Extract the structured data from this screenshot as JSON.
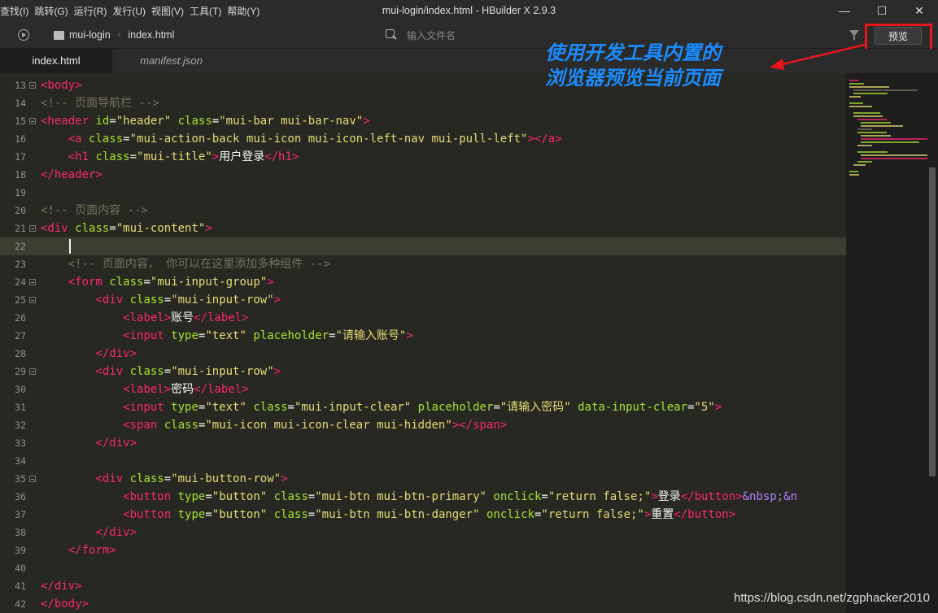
{
  "menu": [
    "查找(I)",
    "跳转(G)",
    "运行(R)",
    "发行(U)",
    "视图(V)",
    "工具(T)",
    "帮助(Y)"
  ],
  "window": {
    "title": "mui-login/index.html - HBuilder X 2.9.3",
    "minimize": "—",
    "maximize": "☐",
    "close": "✕"
  },
  "toolbar": {
    "breadcrumb_project": "mui-login",
    "breadcrumb_file": "index.html",
    "search_placeholder": "输入文件名",
    "preview_label": "预览"
  },
  "tabs": [
    {
      "label": "index.html",
      "active": true
    },
    {
      "label": "manifest.json",
      "active": false
    }
  ],
  "editor": {
    "current_line": 22,
    "lines": [
      {
        "n": "13",
        "fold": true,
        "html": "<span class='t-tag'>&lt;body&gt;</span>"
      },
      {
        "n": "14",
        "fold": false,
        "html": "<span class='t-cmt'>&lt;!-- 页面导航栏 --&gt;</span>"
      },
      {
        "n": "15",
        "fold": true,
        "html": "<span class='t-tag'>&lt;header</span> <span class='t-attr'>id</span>=<span class='t-str'>\"header\"</span> <span class='t-attr'>class</span>=<span class='t-str'>\"mui-bar mui-bar-nav\"</span><span class='t-tag'>&gt;</span>"
      },
      {
        "n": "16",
        "fold": false,
        "html": "    <span class='t-tag'>&lt;a</span> <span class='t-attr'>class</span>=<span class='t-str'>\"mui-action-back mui-icon mui-icon-left-nav mui-pull-left\"</span><span class='t-tag'>&gt;&lt;/a&gt;</span>"
      },
      {
        "n": "17",
        "fold": false,
        "html": "    <span class='t-tag'>&lt;h1</span> <span class='t-attr'>class</span>=<span class='t-str'>\"mui-title\"</span><span class='t-tag'>&gt;</span>用户登录<span class='t-tag'>&lt;/h1&gt;</span>"
      },
      {
        "n": "18",
        "fold": false,
        "html": "<span class='t-tag'>&lt;/header&gt;</span>"
      },
      {
        "n": "19",
        "fold": false,
        "html": ""
      },
      {
        "n": "20",
        "fold": false,
        "html": "<span class='t-cmt'>&lt;!-- 页面内容 --&gt;</span>"
      },
      {
        "n": "21",
        "fold": true,
        "html": "<span class='t-tag'>&lt;div</span> <span class='t-attr'>class</span>=<span class='t-str'>\"mui-content\"</span><span class='t-tag'>&gt;</span>"
      },
      {
        "n": "22",
        "fold": false,
        "html": ""
      },
      {
        "n": "23",
        "fold": false,
        "html": "    <span class='t-cmt'>&lt;!-- 页面内容， 你可以在这里添加多种组件 --&gt;</span>"
      },
      {
        "n": "24",
        "fold": true,
        "html": "    <span class='t-tag'>&lt;form</span> <span class='t-attr'>class</span>=<span class='t-str'>\"mui-input-group\"</span><span class='t-tag'>&gt;</span>"
      },
      {
        "n": "25",
        "fold": true,
        "html": "        <span class='t-tag'>&lt;div</span> <span class='t-attr'>class</span>=<span class='t-str'>\"mui-input-row\"</span><span class='t-tag'>&gt;</span>"
      },
      {
        "n": "26",
        "fold": false,
        "html": "            <span class='t-tag'>&lt;label&gt;</span>账号<span class='t-tag'>&lt;/label&gt;</span>"
      },
      {
        "n": "27",
        "fold": false,
        "html": "            <span class='t-tag'>&lt;input</span> <span class='t-attr'>type</span>=<span class='t-str'>\"text\"</span> <span class='t-attr'>placeholder</span>=<span class='t-str'>\"请输入账号\"</span><span class='t-tag'>&gt;</span>"
      },
      {
        "n": "28",
        "fold": false,
        "html": "        <span class='t-tag'>&lt;/div&gt;</span>"
      },
      {
        "n": "29",
        "fold": true,
        "html": "        <span class='t-tag'>&lt;div</span> <span class='t-attr'>class</span>=<span class='t-str'>\"mui-input-row\"</span><span class='t-tag'>&gt;</span>"
      },
      {
        "n": "30",
        "fold": false,
        "html": "            <span class='t-tag'>&lt;label&gt;</span>密码<span class='t-tag'>&lt;/label&gt;</span>"
      },
      {
        "n": "31",
        "fold": false,
        "html": "            <span class='t-tag'>&lt;input</span> <span class='t-attr'>type</span>=<span class='t-str'>\"text\"</span> <span class='t-attr'>class</span>=<span class='t-str'>\"mui-input-clear\"</span> <span class='t-attr'>placeholder</span>=<span class='t-str'>\"请输入密码\"</span> <span class='t-attr'>data-input-clear</span>=<span class='t-str'>\"5\"</span><span class='t-tag'>&gt;</span>"
      },
      {
        "n": "32",
        "fold": false,
        "html": "            <span class='t-tag'>&lt;span</span> <span class='t-attr'>class</span>=<span class='t-str'>\"mui-icon mui-icon-clear mui-hidden\"</span><span class='t-tag'>&gt;&lt;/span&gt;</span>"
      },
      {
        "n": "33",
        "fold": false,
        "html": "        <span class='t-tag'>&lt;/div&gt;</span>"
      },
      {
        "n": "34",
        "fold": false,
        "html": ""
      },
      {
        "n": "35",
        "fold": true,
        "html": "        <span class='t-tag'>&lt;div</span> <span class='t-attr'>class</span>=<span class='t-str'>\"mui-button-row\"</span><span class='t-tag'>&gt;</span>"
      },
      {
        "n": "36",
        "fold": false,
        "html": "            <span class='t-tag'>&lt;button</span> <span class='t-attr'>type</span>=<span class='t-str'>\"button\"</span> <span class='t-attr'>class</span>=<span class='t-str'>\"mui-btn mui-btn-primary\"</span> <span class='t-attr'>onclick</span>=<span class='t-str'>\"return false;\"</span><span class='t-tag'>&gt;</span>登录<span class='t-tag'>&lt;/button&gt;</span><span class='t-ent'>&amp;nbsp;&amp;n</span>"
      },
      {
        "n": "37",
        "fold": false,
        "html": "            <span class='t-tag'>&lt;button</span> <span class='t-attr'>type</span>=<span class='t-str'>\"button\"</span> <span class='t-attr'>class</span>=<span class='t-str'>\"mui-btn mui-btn-danger\"</span> <span class='t-attr'>onclick</span>=<span class='t-str'>\"return false;\"</span><span class='t-tag'>&gt;</span>重置<span class='t-tag'>&lt;/button&gt;</span>"
      },
      {
        "n": "38",
        "fold": false,
        "html": "        <span class='t-tag'>&lt;/div&gt;</span>"
      },
      {
        "n": "39",
        "fold": false,
        "html": "    <span class='t-tag'>&lt;/form&gt;</span>"
      },
      {
        "n": "40",
        "fold": false,
        "html": ""
      },
      {
        "n": "41",
        "fold": false,
        "html": "<span class='t-tag'>&lt;/div&gt;</span>"
      },
      {
        "n": "42",
        "fold": false,
        "html": "<span class='t-tag'>&lt;/body&gt;</span>"
      }
    ]
  },
  "annotation": {
    "line1": "使用开发工具内置的",
    "line2": "浏览器预览当前页面",
    "color": "#1a8cff",
    "arrow_color": "#e8141e"
  },
  "watermark": "https://blog.csdn.net/zgphacker2010"
}
